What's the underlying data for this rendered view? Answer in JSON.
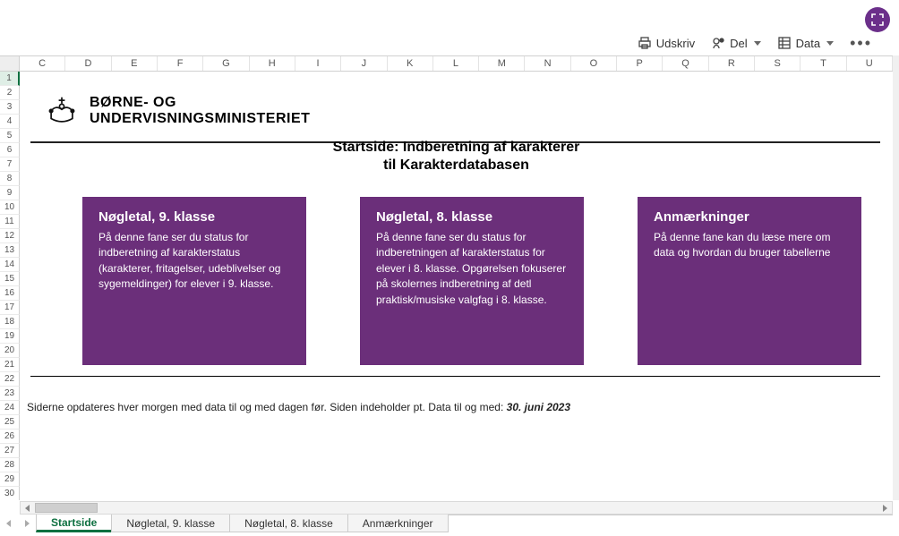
{
  "toolbar": {
    "print_label": "Udskriv",
    "share_label": "Del",
    "data_label": "Data"
  },
  "columns": [
    "C",
    "D",
    "E",
    "F",
    "G",
    "H",
    "I",
    "J",
    "K",
    "L",
    "M",
    "N",
    "O",
    "P",
    "Q",
    "R",
    "S",
    "T",
    "U"
  ],
  "row_count": 30,
  "logo": {
    "line1": "BØRNE- OG",
    "line2": "UNDERVISNINGSMINISTERIET"
  },
  "title": {
    "line1": "Startside: Indberetning af karakterer",
    "line2": "til Karakterdatabasen"
  },
  "cards": [
    {
      "title": "Nøgletal, 9. klasse",
      "body": "På denne fane ser du status for indberetning af karakterstatus (karakterer, fritagelser, udeblivelser og sygemeldinger) for elever i 9. klasse."
    },
    {
      "title": "Nøgletal, 8. klasse",
      "body": "På denne fane ser du status for indberetningen af karakterstatus for elever i 8. klasse. Opgørelsen fokuserer på skolernes indberetning af detl praktisk/musiske valgfag i 8. klasse."
    },
    {
      "title": "Anmærkninger",
      "body": "På denne fane kan du læse mere om data og hvordan du bruger tabellerne"
    }
  ],
  "update_note": {
    "prefix": "Siderne opdateres hver morgen med data til og med dagen før. Siden indeholder pt. Data til og med: ",
    "date": "30. juni 2023"
  },
  "tabs": [
    "Startside",
    "Nøgletal, 9. klasse",
    "Nøgletal, 8. klasse",
    "Anmærkninger"
  ],
  "active_tab_index": 0
}
